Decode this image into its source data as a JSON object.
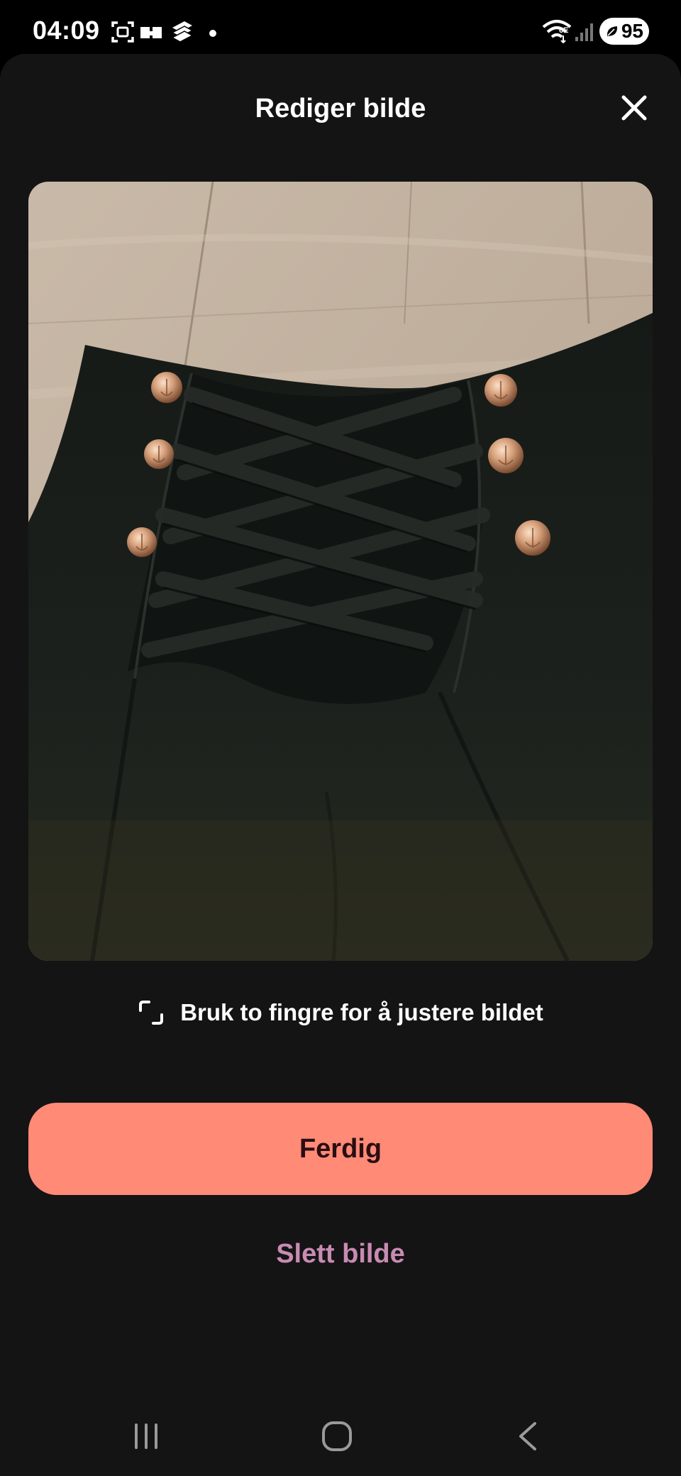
{
  "status_bar": {
    "time": "04:09",
    "battery_level": "95",
    "icons": [
      "screenshot-icon",
      "cast-icon",
      "stack-app-icon",
      "notification-dot-icon",
      "wifi-icon",
      "cellular-signal-icon",
      "battery-icon"
    ]
  },
  "sheet": {
    "title": "Rediger bilde",
    "close_icon": "close-icon"
  },
  "photo": {
    "subject": "black high-waisted pants with crisscross lace-up front and gold anchor buttons on wooden floor"
  },
  "hint": {
    "icon": "crop-adjust-icon",
    "text": "Bruk to fingre for å justere bildet"
  },
  "actions": {
    "primary_label": "Ferdig",
    "secondary_label": "Slett bilde"
  },
  "nav_bar": {
    "recents_icon": "recents-icon",
    "home_icon": "home-icon",
    "back_icon": "back-icon"
  },
  "colors": {
    "background": "#141414",
    "primary_button": "#ff8a76",
    "primary_button_text": "#2a0d12",
    "secondary_link": "#c88bb4"
  }
}
